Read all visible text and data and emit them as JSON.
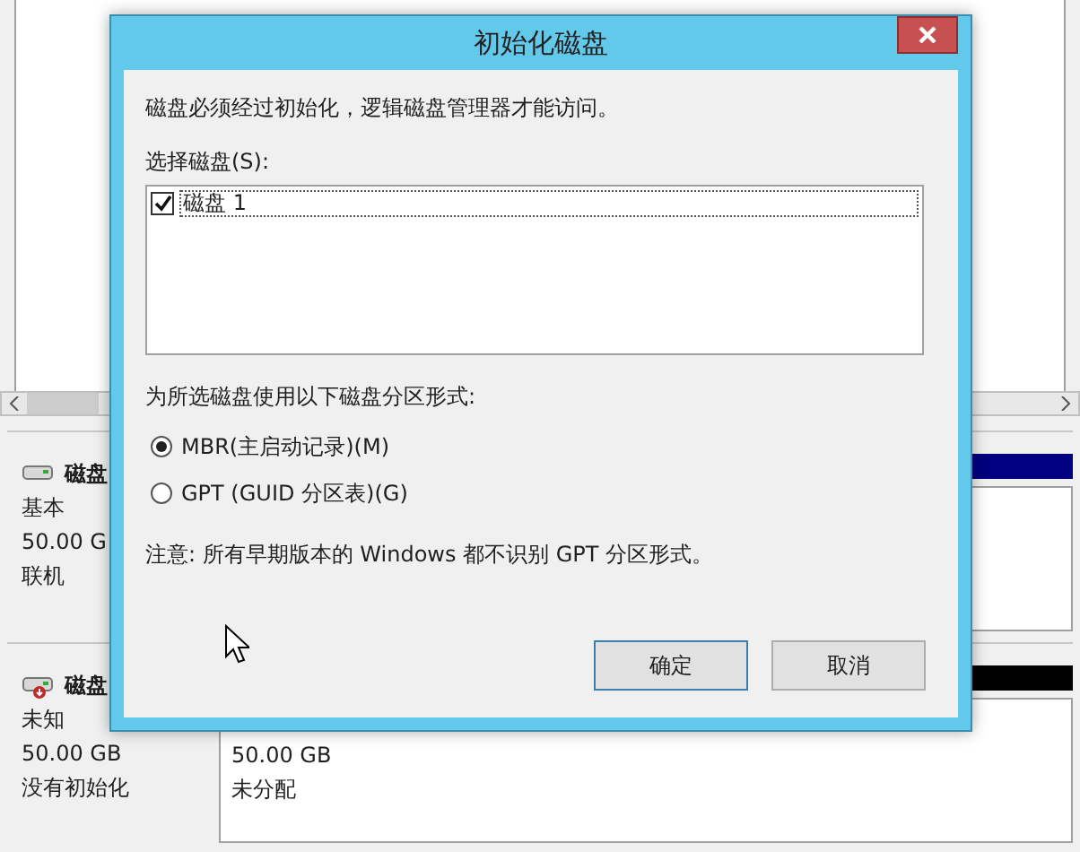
{
  "background": {
    "disks": [
      {
        "kind": "online",
        "name": "磁盘",
        "lines": [
          "基本",
          "50.00 G",
          "联机"
        ],
        "color": "#000080"
      },
      {
        "kind": "unknown",
        "name": "磁盘",
        "lines": [
          "未知",
          "50.00 GB",
          "没有初始化"
        ],
        "color": "#000000",
        "partition": [
          "50.00 GB",
          "未分配"
        ]
      }
    ]
  },
  "dialog": {
    "title": "初始化磁盘",
    "message": "磁盘必须经过初始化，逻辑磁盘管理器才能访问。",
    "select_label": "选择磁盘(S):",
    "disks": [
      {
        "label": "磁盘 1",
        "checked": true
      }
    ],
    "style_label": "为所选磁盘使用以下磁盘分区形式:",
    "styles": [
      {
        "label": "MBR(主启动记录)(M)",
        "selected": true
      },
      {
        "label": "GPT (GUID 分区表)(G)",
        "selected": false
      }
    ],
    "note": "注意: 所有早期版本的 Windows 都不识别 GPT 分区形式。",
    "buttons": [
      {
        "label": "确定",
        "default": true
      },
      {
        "label": "取消",
        "default": false
      }
    ]
  }
}
